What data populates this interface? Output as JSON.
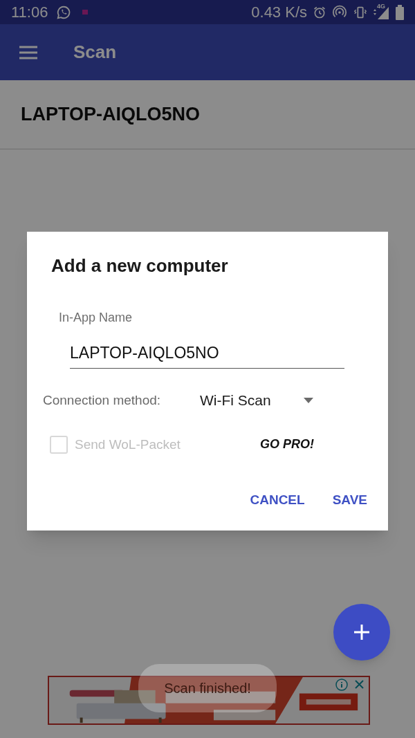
{
  "status_bar": {
    "time": "11:06",
    "speed": "0.43 K/s",
    "network": "4G"
  },
  "app_bar": {
    "title": "Scan"
  },
  "computers": [
    {
      "name": "LAPTOP-AIQLO5NO"
    }
  ],
  "dialog": {
    "title": "Add a new computer",
    "name_field": {
      "label": "In-App Name",
      "value": "LAPTOP-AIQLO5NO"
    },
    "connection": {
      "label": "Connection method:",
      "value": "Wi-Fi Scan"
    },
    "wol": {
      "label": "Send WoL-Packet",
      "checked": false,
      "disabled": true
    },
    "pro_label": "GO PRO!",
    "buttons": [
      {
        "label": "CANCEL"
      },
      {
        "label": "SAVE"
      }
    ]
  },
  "toast": "Scan finished!"
}
